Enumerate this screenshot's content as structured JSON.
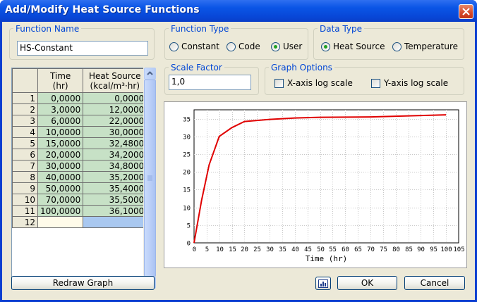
{
  "window": {
    "title": "Add/Modify Heat Source Functions"
  },
  "function_name": {
    "label": "Function Name",
    "value": "HS-Constant"
  },
  "function_type": {
    "label": "Function Type",
    "options": [
      {
        "label": "Constant",
        "checked": false
      },
      {
        "label": "Code",
        "checked": false
      },
      {
        "label": "User",
        "checked": true
      }
    ]
  },
  "data_type": {
    "label": "Data Type",
    "options": [
      {
        "label": "Heat Source",
        "checked": true
      },
      {
        "label": "Temperature",
        "checked": false
      }
    ]
  },
  "scale_factor": {
    "label": "Scale Factor",
    "value": "1,0"
  },
  "graph_options": {
    "label": "Graph Options",
    "x_log": {
      "label": "X-axis log scale",
      "checked": false
    },
    "y_log": {
      "label": "Y-axis log scale",
      "checked": false
    }
  },
  "table": {
    "headers": [
      {
        "line1": "Time",
        "line2": "(hr)"
      },
      {
        "line1": "Heat Source",
        "line2": "(kcal/m³·hr)"
      }
    ],
    "rows": [
      {
        "index": "1",
        "time": "0,0000",
        "value": "0,0000"
      },
      {
        "index": "2",
        "time": "3,0000",
        "value": "12,0000"
      },
      {
        "index": "3",
        "time": "6,0000",
        "value": "22,0000"
      },
      {
        "index": "4",
        "time": "10,0000",
        "value": "30,0000"
      },
      {
        "index": "5",
        "time": "15,0000",
        "value": "32,4800"
      },
      {
        "index": "6",
        "time": "20,0000",
        "value": "34,2000"
      },
      {
        "index": "7",
        "time": "30,0000",
        "value": "34,8000"
      },
      {
        "index": "8",
        "time": "40,0000",
        "value": "35,2000"
      },
      {
        "index": "9",
        "time": "50,0000",
        "value": "35,4000"
      },
      {
        "index": "10",
        "time": "70,0000",
        "value": "35,5000"
      },
      {
        "index": "11",
        "time": "100,0000",
        "value": "36,1000"
      },
      {
        "index": "12",
        "time": "",
        "value": ""
      }
    ]
  },
  "buttons": {
    "redraw": "Redraw Graph",
    "ok": "OK",
    "cancel": "Cancel",
    "chart_icon": "chart-icon"
  },
  "colors": {
    "title_bar": "#0a55e6",
    "group_label": "#0046d5",
    "series_line": "#e00000",
    "cell_green": "#c7e1c6"
  },
  "chart_data": {
    "type": "line",
    "xlabel": "Time (hr)",
    "ylabel": "",
    "xlim": [
      0,
      105
    ],
    "ylim": [
      0,
      37.5
    ],
    "xticks": [
      "0",
      "5",
      "10",
      "15",
      "20",
      "25",
      "30",
      "35",
      "40",
      "45",
      "50",
      "55",
      "60",
      "65",
      "70",
      "75",
      "80",
      "85",
      "90",
      "95",
      "100",
      "105"
    ],
    "yticks": [
      "0",
      "5",
      "10",
      "15",
      "20",
      "25",
      "30",
      "35"
    ],
    "grid": true,
    "series": [
      {
        "x": [
          0,
          3,
          6,
          10,
          15,
          20,
          30,
          40,
          50,
          70,
          100
        ],
        "y": [
          0,
          12,
          22,
          30,
          32.48,
          34.2,
          34.8,
          35.2,
          35.4,
          35.5,
          36.1
        ]
      }
    ]
  }
}
